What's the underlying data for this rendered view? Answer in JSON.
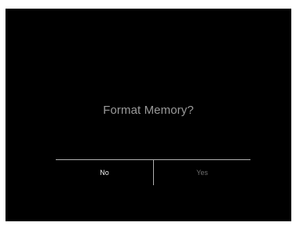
{
  "dialog": {
    "title": "Format Memory?",
    "options": [
      {
        "label": "No",
        "selected": true
      },
      {
        "label": "Yes",
        "selected": false
      }
    ]
  },
  "colors": {
    "background": "#000000",
    "title": "#9a9a9a",
    "selected_option": "#f2f2f2",
    "unselected_option": "#6e6e6e",
    "divider": "#b0b0b0"
  }
}
